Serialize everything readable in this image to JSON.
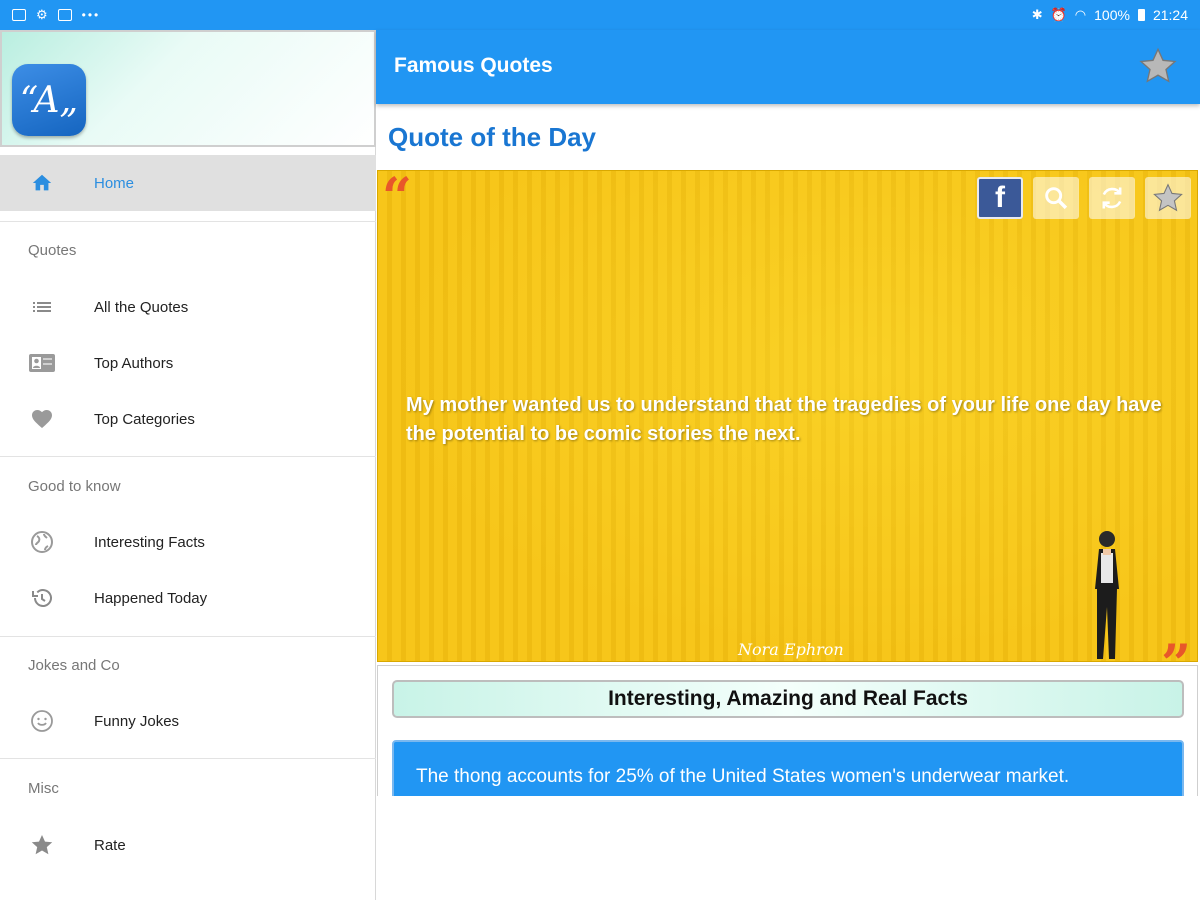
{
  "status_bar": {
    "battery": "100%",
    "time": "21:24"
  },
  "drawer": {
    "logo_text": "“A„",
    "items": [
      {
        "label": "Home",
        "icon": "home-icon",
        "active": true
      },
      {
        "label": "All the Quotes",
        "icon": "list-icon"
      },
      {
        "label": "Top Authors",
        "icon": "contact-card-icon"
      },
      {
        "label": "Top Categories",
        "icon": "heart-icon"
      },
      {
        "label": "Interesting Facts",
        "icon": "globe-icon"
      },
      {
        "label": "Happened Today",
        "icon": "history-icon"
      },
      {
        "label": "Funny Jokes",
        "icon": "smiley-icon"
      },
      {
        "label": "Rate",
        "icon": "star-icon"
      }
    ],
    "sections": {
      "quotes": "Quotes",
      "good_to_know": "Good to know",
      "jokes": "Jokes and Co",
      "misc": "Misc"
    }
  },
  "appbar": {
    "title": "Famous Quotes",
    "favorite_icon": "star-icon"
  },
  "main": {
    "qotd_title": "Quote of the Day",
    "quote": {
      "text": "My mother wanted us to understand that the tragedies of your life one day have the potential to be comic stories the next.",
      "author": "Nora Ephron",
      "actions": [
        "facebook-icon",
        "search-icon",
        "refresh-icon",
        "star-icon"
      ]
    },
    "facts": {
      "header": "Interesting, Amazing and Real Facts",
      "fact": "The thong accounts for 25% of the United States women's underwear market."
    }
  },
  "colors": {
    "primary": "#2196f3",
    "accent_text": "#1976d2",
    "quote_bg": "#f7c61a",
    "quote_marks": "#e8572a"
  }
}
